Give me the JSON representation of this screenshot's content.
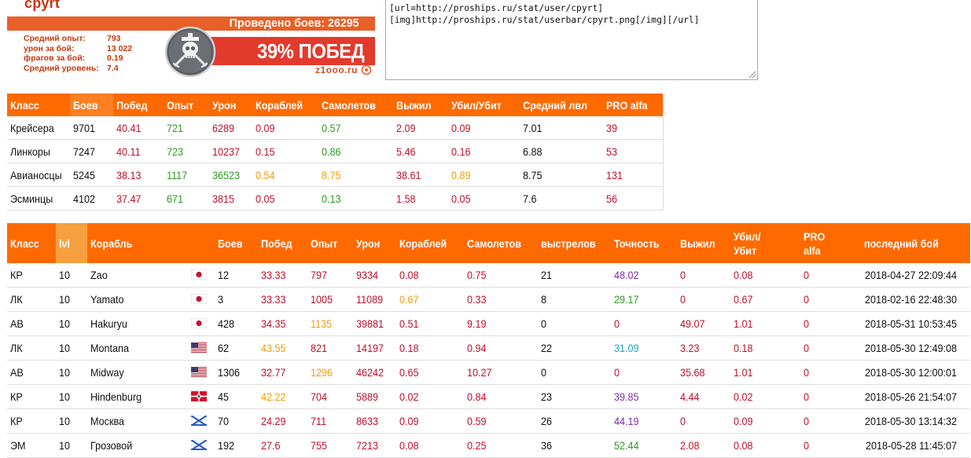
{
  "userbar": {
    "name": "cpyrt",
    "battles_label": "Проведено боев: 26295",
    "stats": [
      {
        "label": "Средний опыт:",
        "value": "793"
      },
      {
        "label": "урон за бой:",
        "value": "13 022"
      },
      {
        "label": "фрагов за бой:",
        "value": "0.19"
      },
      {
        "label": "Средний уровень:",
        "value": "7.4"
      }
    ],
    "wins_label": "39% ПОБЕД",
    "site": "z1ooo.ru",
    "emblem_icon": "skull-crossed-swords-emblem",
    "colors": {
      "accent": "#e85f28",
      "wins_bar": "#e23a2c",
      "name": "#c8370a"
    }
  },
  "bbcode": {
    "text": "[url=http://proships.ru/stat/user/cpyrt]\n[img]http://proships.ru/stat/userbar/cpyrt.png[/img][/url]"
  },
  "class_table": {
    "headers": [
      "Класс",
      "Боев",
      "Побед",
      "Опыт",
      "Урон",
      "Кораблей",
      "Самолетов",
      "Выжил",
      "Убил/Убит",
      "Средний лвл",
      "PRO alfa"
    ],
    "rows": [
      [
        "Крейсера",
        "9701",
        "40.41",
        "721",
        "6289",
        "0.09",
        "0.57",
        "2.09",
        "0.09",
        "7.01",
        "39"
      ],
      [
        "Линкоры",
        "7247",
        "40.11",
        "723",
        "10237",
        "0.15",
        "0.86",
        "5.46",
        "0.16",
        "6.88",
        "53"
      ],
      [
        "Авианосцы",
        "5245",
        "38.13",
        "1117",
        "36523",
        "0.54",
        "8.75",
        "38.61",
        "0.89",
        "8.75",
        "131"
      ],
      [
        "Эсминцы",
        "4102",
        "37.47",
        "671",
        "3815",
        "0.05",
        "0.13",
        "1.58",
        "0.05",
        "7.6",
        "56"
      ]
    ],
    "colors": [
      [
        "dark",
        "dark",
        "red",
        "green",
        "red",
        "red",
        "green",
        "red",
        "red",
        "dark",
        "red"
      ],
      [
        "dark",
        "dark",
        "red",
        "green",
        "red",
        "red",
        "green",
        "red",
        "red",
        "dark",
        "red"
      ],
      [
        "dark",
        "dark",
        "red",
        "green",
        "green",
        "orange",
        "orange",
        "red",
        "orange",
        "dark",
        "red"
      ],
      [
        "dark",
        "dark",
        "red",
        "green",
        "red",
        "red",
        "green",
        "red",
        "red",
        "dark",
        "red"
      ]
    ]
  },
  "ship_table": {
    "headers": [
      "Класс",
      "lvl",
      "Корабль",
      "Боев",
      "Побед",
      "Опыт",
      "Урон",
      "Кораблей",
      "Самолетов",
      "выстрелов",
      "Точность",
      "Выжил",
      "Убил/ Убит",
      "PRO alfa",
      "последний бой"
    ],
    "rows": [
      {
        "cls": "КР",
        "lvl": "10",
        "ship": "Zao",
        "flag": "japan-flag-icon",
        "battles": "12",
        "wins": "33.33",
        "exp": "797",
        "dmg": "9334",
        "ships": "0.08",
        "planes": "0.75",
        "shots": "21",
        "acc": "48.02",
        "surv": "0",
        "kd": "0.08",
        "pro": "0",
        "last": "2018-04-27 22:09:44",
        "c": {
          "wins": "red",
          "exp": "red",
          "dmg": "red",
          "ships": "red",
          "planes": "red",
          "acc": "purple",
          "surv": "red",
          "kd": "red",
          "pro": "red"
        }
      },
      {
        "cls": "ЛК",
        "lvl": "10",
        "ship": "Yamato",
        "flag": "japan-flag-icon",
        "battles": "3",
        "wins": "33.33",
        "exp": "1005",
        "dmg": "11089",
        "ships": "0.67",
        "planes": "0.33",
        "shots": "8",
        "acc": "29.17",
        "surv": "0",
        "kd": "0.67",
        "pro": "0",
        "last": "2018-02-16 22:48:30",
        "c": {
          "wins": "red",
          "exp": "red",
          "dmg": "red",
          "ships": "orange",
          "planes": "red",
          "acc": "green",
          "surv": "red",
          "kd": "red",
          "pro": "red"
        }
      },
      {
        "cls": "АВ",
        "lvl": "10",
        "ship": "Hakuryu",
        "flag": "japan-flag-icon",
        "battles": "428",
        "wins": "34.35",
        "exp": "1135",
        "dmg": "39881",
        "ships": "0.51",
        "planes": "9.19",
        "shots": "0",
        "acc": "0",
        "surv": "49.07",
        "kd": "1.01",
        "pro": "0",
        "last": "2018-05-31 10:53:45",
        "c": {
          "wins": "red",
          "exp": "orange",
          "dmg": "red",
          "ships": "red",
          "planes": "red",
          "acc": "red",
          "surv": "red",
          "kd": "red",
          "pro": "red"
        }
      },
      {
        "cls": "ЛК",
        "lvl": "10",
        "ship": "Montana",
        "flag": "usa-flag-icon",
        "battles": "62",
        "wins": "43.55",
        "exp": "821",
        "dmg": "14197",
        "ships": "0.18",
        "planes": "0.94",
        "shots": "22",
        "acc": "31.09",
        "surv": "3.23",
        "kd": "0.18",
        "pro": "0",
        "last": "2018-05-30 12:49:08",
        "c": {
          "wins": "orange",
          "exp": "red",
          "dmg": "red",
          "ships": "red",
          "planes": "red",
          "acc": "teal",
          "surv": "red",
          "kd": "red",
          "pro": "red"
        }
      },
      {
        "cls": "АВ",
        "lvl": "10",
        "ship": "Midway",
        "flag": "usa-flag-icon",
        "battles": "1306",
        "wins": "32.77",
        "exp": "1296",
        "dmg": "46242",
        "ships": "0.65",
        "planes": "10.27",
        "shots": "0",
        "acc": "0",
        "surv": "35.68",
        "kd": "1.01",
        "pro": "0",
        "last": "2018-05-30 12:00:01",
        "c": {
          "wins": "red",
          "exp": "orange",
          "dmg": "red",
          "ships": "red",
          "planes": "red",
          "acc": "red",
          "surv": "red",
          "kd": "red",
          "pro": "red"
        }
      },
      {
        "cls": "КР",
        "lvl": "10",
        "ship": "Hindenburg",
        "flag": "germany-kriegsmarine-flag-icon",
        "battles": "45",
        "wins": "42.22",
        "exp": "704",
        "dmg": "5889",
        "ships": "0.02",
        "planes": "0.84",
        "shots": "23",
        "acc": "39.85",
        "surv": "4.44",
        "kd": "0.02",
        "pro": "0",
        "last": "2018-05-26 21:54:07",
        "c": {
          "wins": "orange",
          "exp": "red",
          "dmg": "red",
          "ships": "red",
          "planes": "red",
          "acc": "purple",
          "surv": "red",
          "kd": "red",
          "pro": "red"
        }
      },
      {
        "cls": "КР",
        "lvl": "10",
        "ship": "Москва",
        "flag": "ussr-navy-flag-icon",
        "battles": "70",
        "wins": "24.29",
        "exp": "711",
        "dmg": "8633",
        "ships": "0.09",
        "planes": "0.59",
        "shots": "26",
        "acc": "44.19",
        "surv": "0",
        "kd": "0.09",
        "pro": "0",
        "last": "2018-05-30 13:14:32",
        "c": {
          "wins": "red",
          "exp": "red",
          "dmg": "red",
          "ships": "red",
          "planes": "red",
          "acc": "purple",
          "surv": "red",
          "kd": "red",
          "pro": "red"
        }
      },
      {
        "cls": "ЭМ",
        "lvl": "10",
        "ship": "Грозовой",
        "flag": "ussr-navy-flag-icon",
        "battles": "192",
        "wins": "27.6",
        "exp": "755",
        "dmg": "7213",
        "ships": "0.08",
        "planes": "0.25",
        "shots": "36",
        "acc": "52.44",
        "surv": "2.08",
        "kd": "0.08",
        "pro": "0",
        "last": "2018-05-28 11:45:07",
        "c": {
          "wins": "red",
          "exp": "red",
          "dmg": "red",
          "ships": "red",
          "planes": "red",
          "acc": "green",
          "surv": "red",
          "kd": "red",
          "pro": "red"
        }
      }
    ]
  }
}
